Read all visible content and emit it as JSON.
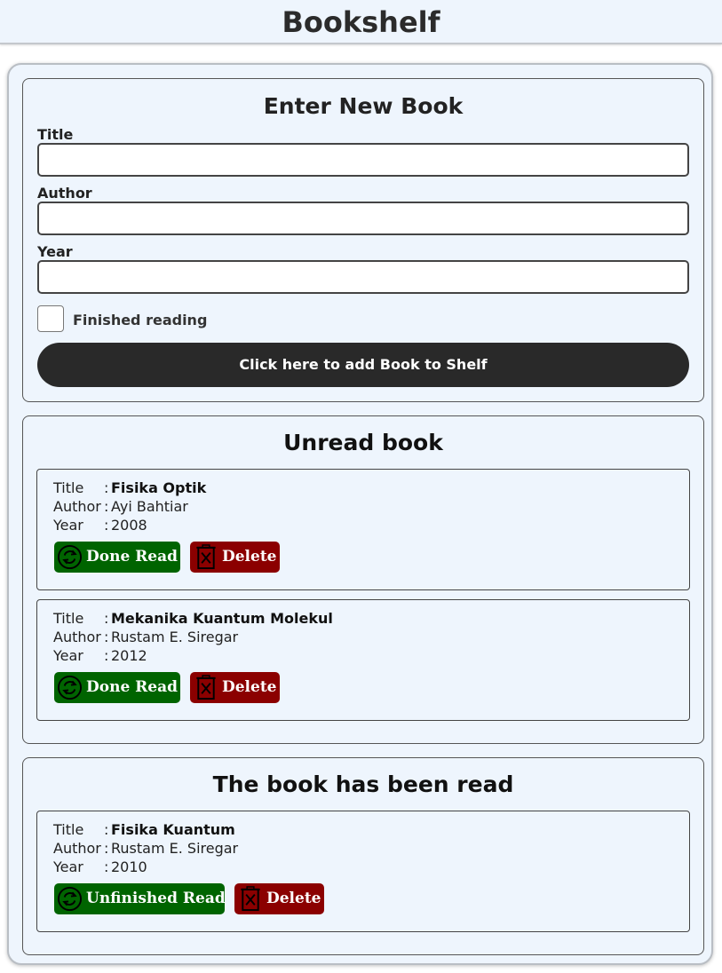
{
  "header": {
    "title": "Bookshelf"
  },
  "input_section": {
    "heading": "Enter New Book",
    "title_label": "Title",
    "author_label": "Author",
    "year_label": "Year",
    "title_value": "",
    "author_value": "",
    "year_value": "",
    "checkbox_label": "Finished reading",
    "submit_label": "Click here to add Book to Shelf"
  },
  "unread_section": {
    "heading": "Unread book",
    "books": [
      {
        "title_key": "Title",
        "author_key": "Author",
        "year_key": "Year",
        "sep": ":",
        "title": "Fisika Optik",
        "author": "Ayi Bahtiar",
        "year": "2008",
        "action_label": "Done Read",
        "delete_label": "Delete"
      },
      {
        "title_key": "Title",
        "author_key": "Author",
        "year_key": "Year",
        "sep": ":",
        "title": "Mekanika Kuantum Molekul",
        "author": "Rustam E. Siregar",
        "year": "2012",
        "action_label": "Done Read",
        "delete_label": "Delete"
      }
    ]
  },
  "read_section": {
    "heading": "The book has been read",
    "books": [
      {
        "title_key": "Title",
        "author_key": "Author",
        "year_key": "Year",
        "sep": ":",
        "title": "Fisika Kuantum",
        "author": "Rustam E. Siregar",
        "year": "2010",
        "action_label": "Unfinished Read",
        "delete_label": "Delete"
      }
    ]
  },
  "icons": {
    "action": "refresh-icon",
    "delete": "trash-icon"
  },
  "colors": {
    "action_button": "#006400",
    "delete_button": "#8b0000",
    "submit_button": "#292929",
    "background": "#eef5fd"
  }
}
